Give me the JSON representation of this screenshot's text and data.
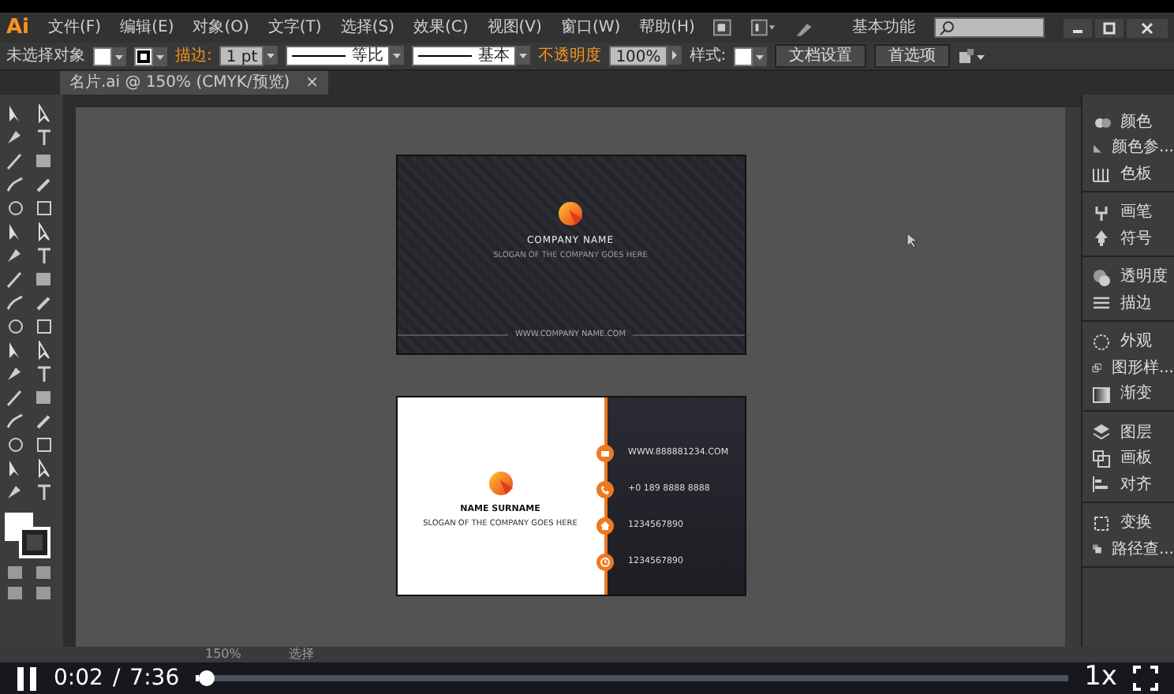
{
  "menu_bar": {
    "logo": "Ai",
    "menus": [
      "文件(F)",
      "编辑(E)",
      "对象(O)",
      "文字(T)",
      "选择(S)",
      "效果(C)",
      "视图(V)",
      "窗口(W)",
      "帮助(H)"
    ],
    "workspace": "基本功能"
  },
  "control_bar": {
    "selection": "未选择对象",
    "stroke_label": "描边:",
    "stroke_weight": "1 pt",
    "profile": "等比",
    "brush": "基本",
    "opacity_label": "不透明度",
    "opacity": "100%",
    "style_label": "样式:",
    "buttons": [
      "文档设置",
      "首选项"
    ]
  },
  "document_tab": {
    "title": "名片.ai @ 150% (CMYK/预览)",
    "close": "×"
  },
  "front_card": {
    "company": "COMPANY NAME",
    "slogan": "SLOGAN OF THE COMPANY GOES HERE",
    "website": "WWW.COMPANY NAME.COM"
  },
  "back_card": {
    "name": "NAME SURNAME",
    "slogan": "SLOGAN OF THE COMPANY GOES HERE",
    "contacts": [
      {
        "kind": "email",
        "text": "WWW.888881234.COM"
      },
      {
        "kind": "phone",
        "text": "+0 189 8888 8888"
      },
      {
        "kind": "home",
        "text": "1234567890"
      },
      {
        "kind": "clock",
        "text": "1234567890"
      }
    ]
  },
  "panels": [
    [
      {
        "kind": "color",
        "label": "颜色"
      },
      {
        "kind": "guide",
        "label": "颜色参..."
      },
      {
        "kind": "swatches",
        "label": "色板"
      }
    ],
    [
      {
        "kind": "brush",
        "label": "画笔"
      },
      {
        "kind": "symbol",
        "label": "符号"
      }
    ],
    [
      {
        "kind": "transparency",
        "label": "透明度"
      },
      {
        "kind": "stroke",
        "label": "描边"
      }
    ],
    [
      {
        "kind": "appearance",
        "label": "外观"
      },
      {
        "kind": "styles",
        "label": "图形样..."
      },
      {
        "kind": "gradient",
        "label": "渐变"
      }
    ],
    [
      {
        "kind": "layers",
        "label": "图层"
      },
      {
        "kind": "artboards",
        "label": "画板"
      },
      {
        "kind": "align",
        "label": "对齐"
      }
    ],
    [
      {
        "kind": "transform",
        "label": "变换"
      },
      {
        "kind": "pathfinder",
        "label": "路径查..."
      }
    ]
  ],
  "status_bar": {
    "zoom": "150%",
    "tool": "选择"
  },
  "player": {
    "playing": true,
    "time": "0:02",
    "separator": "/",
    "duration": "7:36",
    "level": 0.0044,
    "speed": "1x"
  }
}
